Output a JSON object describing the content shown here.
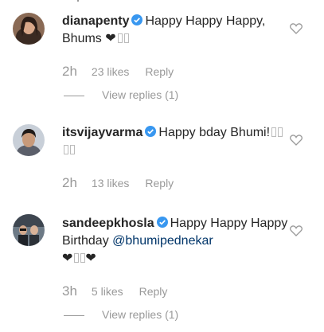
{
  "comments": [
    {
      "username": "dianapenty",
      "verified": true,
      "text_before": "Happy Happy Happy, Bhums",
      "emoji": "❤",
      "time": "2h",
      "likes": "23 likes",
      "reply": "Reply",
      "view_replies": "View replies (1)"
    },
    {
      "username": "itsvijayvarma",
      "verified": true,
      "text_before": "Happy bday Bhumi!",
      "time": "2h",
      "likes": "13 likes",
      "reply": "Reply"
    },
    {
      "username": "sandeepkhosla",
      "verified": true,
      "text_before": "Happy Happy Happy Birthday",
      "mention": "@bhumipednekar",
      "emoji_line": "❤",
      "emoji_line_end": "❤",
      "time": "3h",
      "likes": "5 likes",
      "reply": "Reply",
      "view_replies": "View replies (1)"
    }
  ],
  "icons": {
    "like": "heart-outline-icon",
    "verified": "verified-badge-icon"
  },
  "colors": {
    "text": "#262626",
    "meta": "#999999",
    "verified": "#3897f0",
    "mention": "#003569"
  }
}
